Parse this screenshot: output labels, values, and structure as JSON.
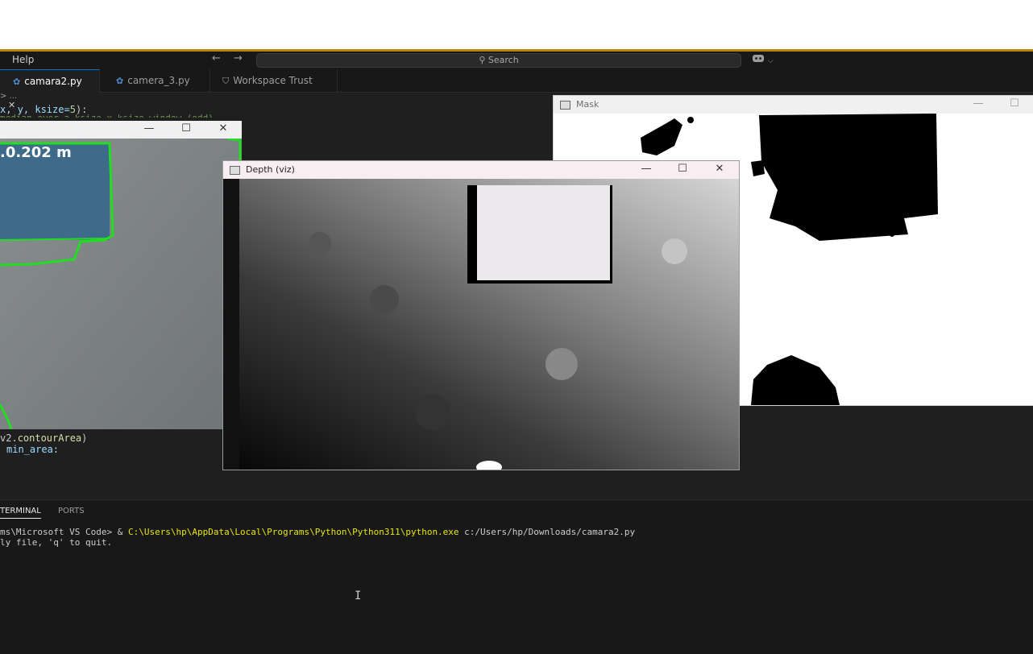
{
  "menu": {
    "help": "Help"
  },
  "titlebar": {
    "back_icon": "←",
    "forward_icon": "→",
    "search_placeholder": "Search",
    "search_icon": "⚲",
    "copilot_icon": "copilot-icon",
    "copilot_chevron": "⌵"
  },
  "tabs": [
    {
      "label": "camara2.py",
      "close": "✕"
    },
    {
      "label": "camera_3.py"
    },
    {
      "label": "Workspace Trust"
    }
  ],
  "breadcrumb": "> ...",
  "code_top": {
    "params": "x, y, ksize=",
    "ksize": "5",
    "end": "):",
    "faded": "median over a ksize x ksize window (odd)."
  },
  "code_bottom": {
    "line1_prefix": "v2.",
    "line1_fn": "contourArea",
    "line1_end": ")",
    "line2_var": "min_area",
    "line2_end": ":"
  },
  "panel": {
    "tab_terminal": "TERMINAL",
    "tab_ports": "PORTS"
  },
  "terminal": {
    "line1_prompt": "ms\\Microsoft VS Code> & ",
    "line1_exe": "C:\\Users\\hp\\AppData\\Local\\Programs\\Python\\Python311\\python.exe",
    "line1_arg": " c:/Users/hp/Downloads/camara2.py",
    "line2": "ly file, 'q' to quit."
  },
  "windows": {
    "camera": {
      "measurement": ".0.202 m",
      "minimize": "—",
      "maximize": "☐",
      "close": "✕"
    },
    "depth": {
      "title": "Depth (viz)",
      "minimize": "—",
      "maximize": "☐",
      "close": "✕"
    },
    "mask": {
      "title": "Mask",
      "minimize": "—",
      "maximize": "☐"
    }
  },
  "cursor": "I",
  "colors": {
    "accent": "#b8860b",
    "contour": "#22dd22",
    "terminal_path": "#e5e510"
  }
}
